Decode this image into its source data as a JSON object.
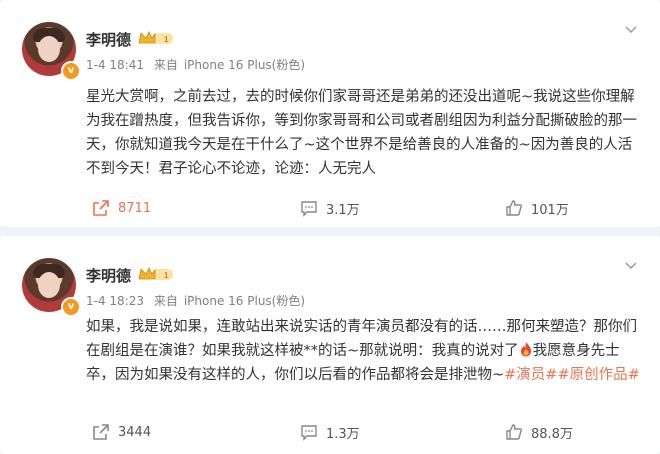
{
  "posts": [
    {
      "author": "李明德",
      "time": "1-4 18:41",
      "source_prefix": "来自",
      "source": "iPhone 16 Plus(粉色)",
      "text": "星光大赏啊，之前去过，去的时候你们家哥哥还是弟弟的还没出道呢~我说这些你理解为我在蹭热度，但我告诉你，等到你家哥哥和公司或者剧组因为利益分配撕破脸的那一天，你就知道我今天是在干什么了~这个世界不是给善良的人准备的~因为善良的人活不到今天！君子论心不论迹，论迹：人无完人",
      "reposts": "8711",
      "comments": "3.1万",
      "likes": "101万",
      "repost_color": "#eb7350"
    },
    {
      "author": "李明德",
      "time": "1-4 18:23",
      "source_prefix": "来自",
      "source": "iPhone 16 Plus(粉色)",
      "text_before": "如果，我是说如果，连敢站出来说实话的青年演员都没有的话……那何来塑造？那你们在剧组是在演谁？如果我就这样被**的话~那就说明：我真的说对了",
      "text_after": "我愿意身先士卒，因为如果没有这样的人，你们以后看的作品都将会是排泄物~",
      "topic1": "#演员#",
      "topic2": "#原创作品#",
      "reposts": "3444",
      "comments": "1.3万",
      "likes": "88.8万"
    }
  ],
  "icons": {
    "avatar_badge": "verified-v-icon",
    "menu": "chevron-down-icon",
    "repost": "repost-icon",
    "comment": "comment-icon",
    "like": "like-icon",
    "crown": "crown-level-icon",
    "fire": "fire-emoji-icon"
  },
  "colors": {
    "accent": "#eb7350",
    "badge": "#f39a1e"
  }
}
